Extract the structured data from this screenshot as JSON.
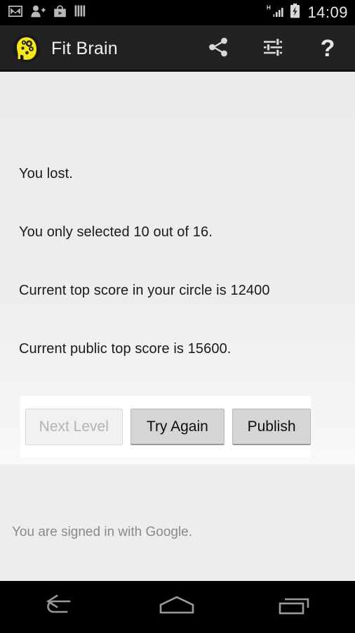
{
  "status_bar": {
    "time": "14:09",
    "network_type": "H",
    "left_icons": [
      {
        "name": "gmail-icon",
        "label": "Gmail"
      },
      {
        "name": "add-contact-icon",
        "label": "Add contact"
      },
      {
        "name": "play-store-icon",
        "label": "Play Store"
      },
      {
        "name": "bars-icon",
        "label": "Bars"
      }
    ],
    "right_icons": [
      {
        "name": "signal-icon",
        "label": "H signal"
      },
      {
        "name": "battery-charging-icon",
        "label": "Battery charging"
      }
    ]
  },
  "action_bar": {
    "app_name": "Fit Brain",
    "app_icon": "brain-gears-icon",
    "actions": [
      {
        "name": "share-icon",
        "label": "Share"
      },
      {
        "name": "tune-icon",
        "label": "Settings"
      },
      {
        "name": "help-icon",
        "label": "Help",
        "glyph": "?"
      }
    ]
  },
  "main": {
    "messages": [
      "You lost.",
      "You only selected 10 out of 16.",
      "Current top score in your circle is 12400",
      "Current public top score is 15600."
    ],
    "buttons": [
      {
        "label": "Next Level",
        "enabled": false
      },
      {
        "label": "Try Again",
        "enabled": true
      },
      {
        "label": "Publish",
        "enabled": true
      }
    ],
    "signin_status": "You are signed in with Google."
  },
  "nav_bar": {
    "buttons": [
      {
        "name": "back-icon",
        "label": "Back"
      },
      {
        "name": "home-icon",
        "label": "Home"
      },
      {
        "name": "recents-icon",
        "label": "Recent apps"
      }
    ]
  },
  "colors": {
    "action_bar_bg": "#222224",
    "accent_yellow": "#f5e618",
    "status_bg": "#000000",
    "content_bg": "#ededed",
    "panel_bg": "#ffffff"
  }
}
